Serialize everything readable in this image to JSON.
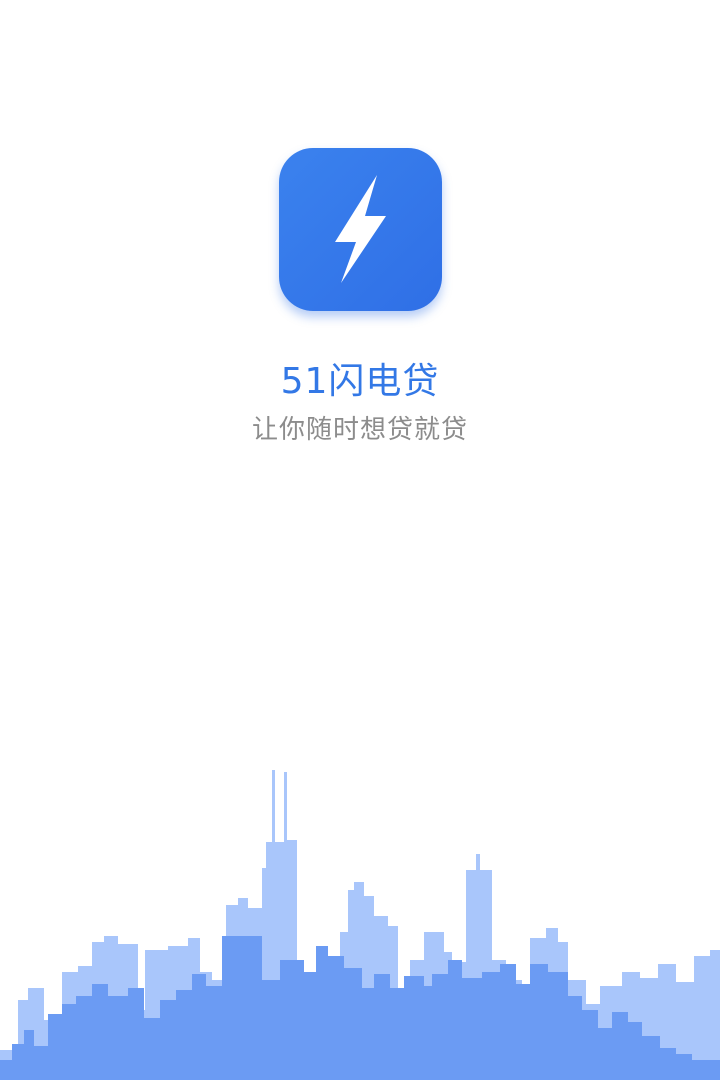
{
  "app": {
    "name": "51闪电贷",
    "slogan": "让你随时想贷就贷",
    "logo_icon": "lightning-bolt-icon",
    "accent_color": "#3378e6",
    "slogan_color": "#8c8c8c"
  },
  "decoration": {
    "skyline": "city-skyline",
    "back_color": "#a9c6fb",
    "front_color": "#6b9bf3"
  }
}
